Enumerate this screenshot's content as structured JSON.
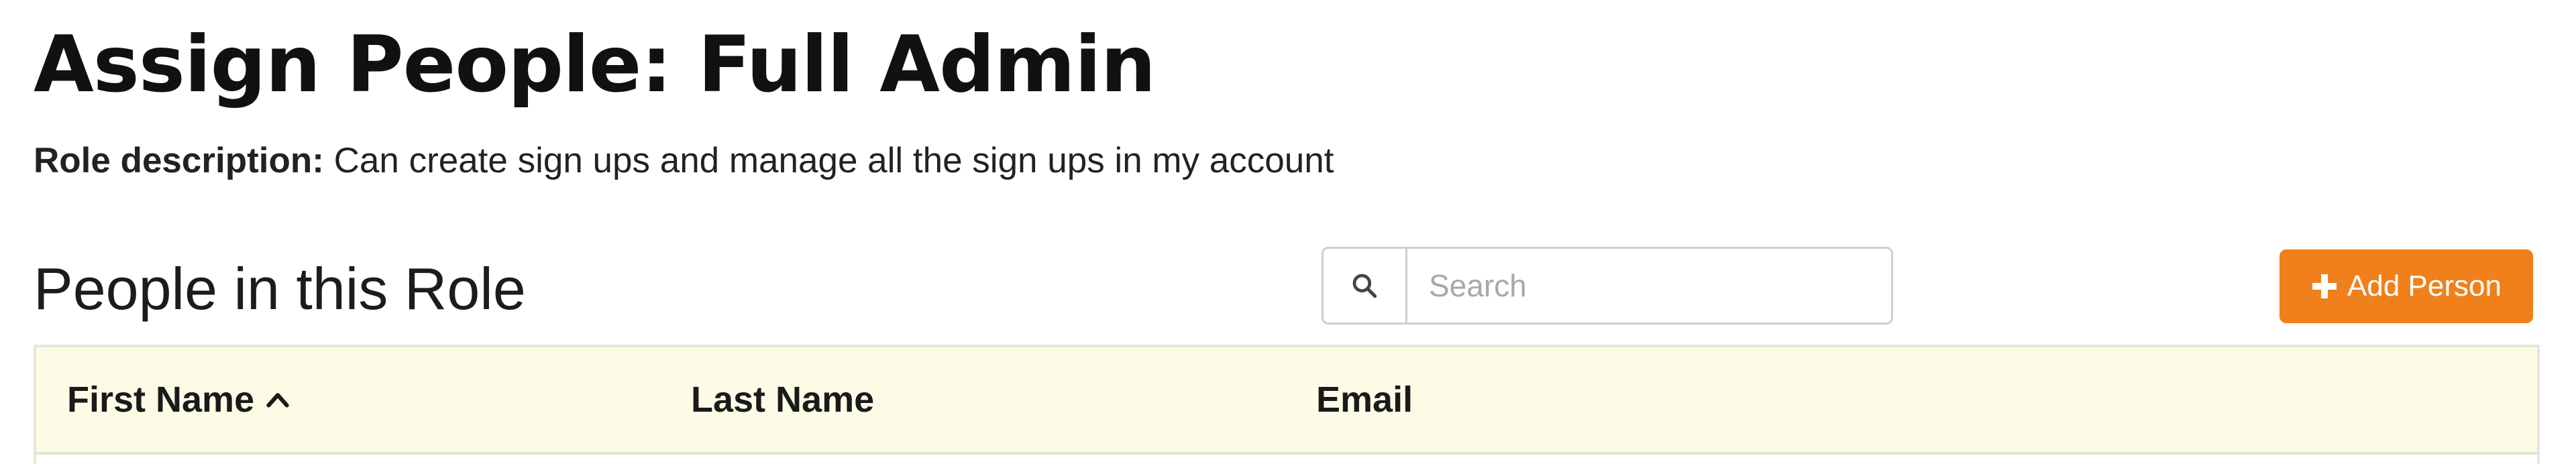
{
  "page": {
    "title": "Assign People: Full Admin",
    "role_description_label": "Role description:",
    "role_description_text": "Can create sign ups and manage all the sign ups in my account"
  },
  "section": {
    "title": "People in this Role"
  },
  "search": {
    "icon": "search-icon",
    "placeholder": "Search",
    "value": ""
  },
  "toolbar": {
    "add_person_label": "Add Person",
    "add_person_icon": "plus-icon",
    "add_person_color": "#f0801c"
  },
  "table": {
    "header_bg": "#fcfce6",
    "columns": [
      {
        "label": "First Name",
        "sorted": "ascending",
        "sort_icon": "chevron-up-icon"
      },
      {
        "label": "Last Name"
      },
      {
        "label": "Email"
      }
    ],
    "rows": []
  }
}
